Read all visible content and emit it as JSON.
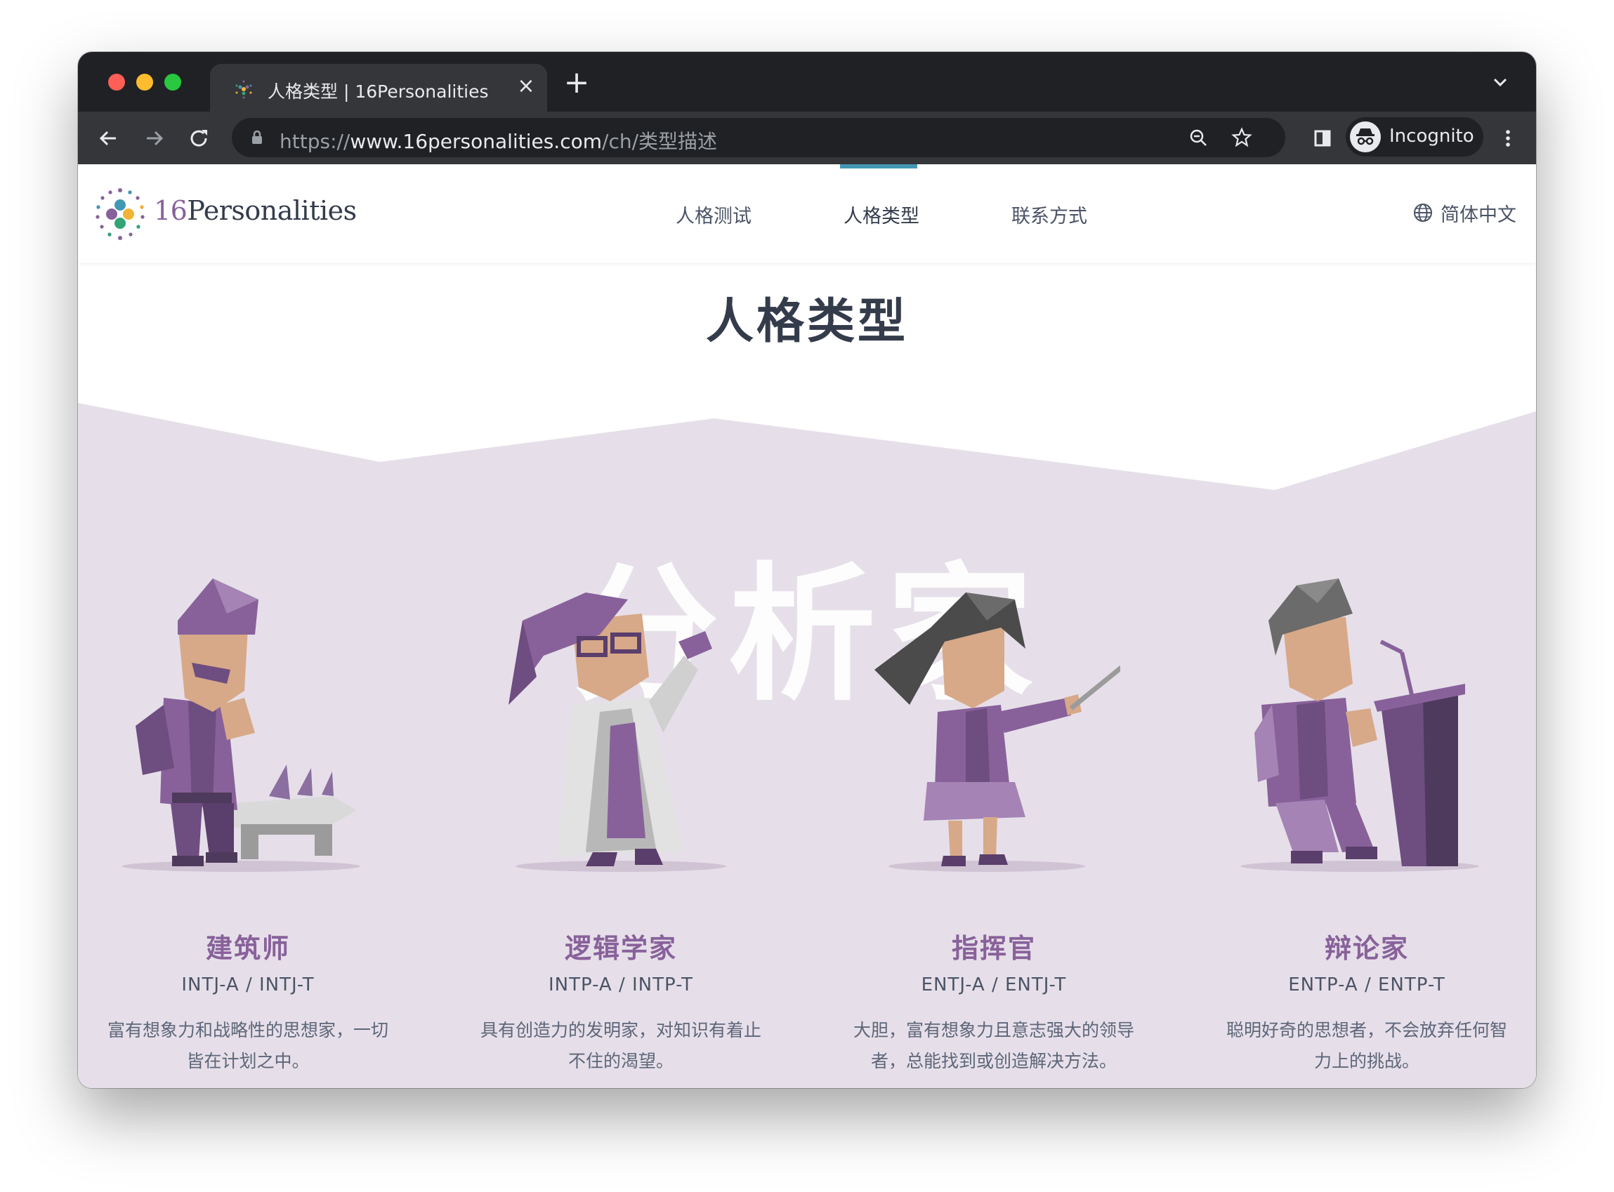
{
  "browser": {
    "tab_title": "人格类型 | 16Personalities",
    "tab_close": "×",
    "new_tab": "+",
    "url_scheme": "https://",
    "url_host": "www.16personalities.com",
    "url_path": "/ch/类型描述",
    "incognito_label": "Incognito",
    "icons": [
      "back-icon",
      "forward-icon",
      "reload-icon",
      "lock-icon",
      "zoom-icon",
      "star-icon",
      "sidepanel-icon",
      "incognito-icon",
      "more-icon",
      "tab-list-icon"
    ]
  },
  "header": {
    "logo_number": "16",
    "logo_word": "Personalities",
    "nav": [
      {
        "label": "人格测试",
        "active": false
      },
      {
        "label": "人格类型",
        "active": true
      },
      {
        "label": "联系方式",
        "active": false
      }
    ],
    "language": "简体中文"
  },
  "main": {
    "title": "人格类型",
    "role_group": "分析家",
    "types": [
      {
        "name": "建筑师",
        "code": "INTJ-A / INTJ-T",
        "description": "富有想象力和战略性的思想家，一切皆在计划之中。"
      },
      {
        "name": "逻辑学家",
        "code": "INTP-A / INTP-T",
        "description": "具有创造力的发明家，对知识有着止不住的渴望。"
      },
      {
        "name": "指挥官",
        "code": "ENTJ-A / ENTJ-T",
        "description": "大胆，富有想象力且意志强大的领导者，总能找到或创造解决方法。"
      },
      {
        "name": "辩论家",
        "code": "ENTP-A / ENTP-T",
        "description": "聪明好奇的思想者，不会放弃任何智力上的挑战。"
      }
    ]
  },
  "colors": {
    "brand_purple": "#88619a",
    "band_lavender": "#e6dfe9",
    "nav_accent": "#4298b4",
    "text_dark": "#343c4b"
  }
}
